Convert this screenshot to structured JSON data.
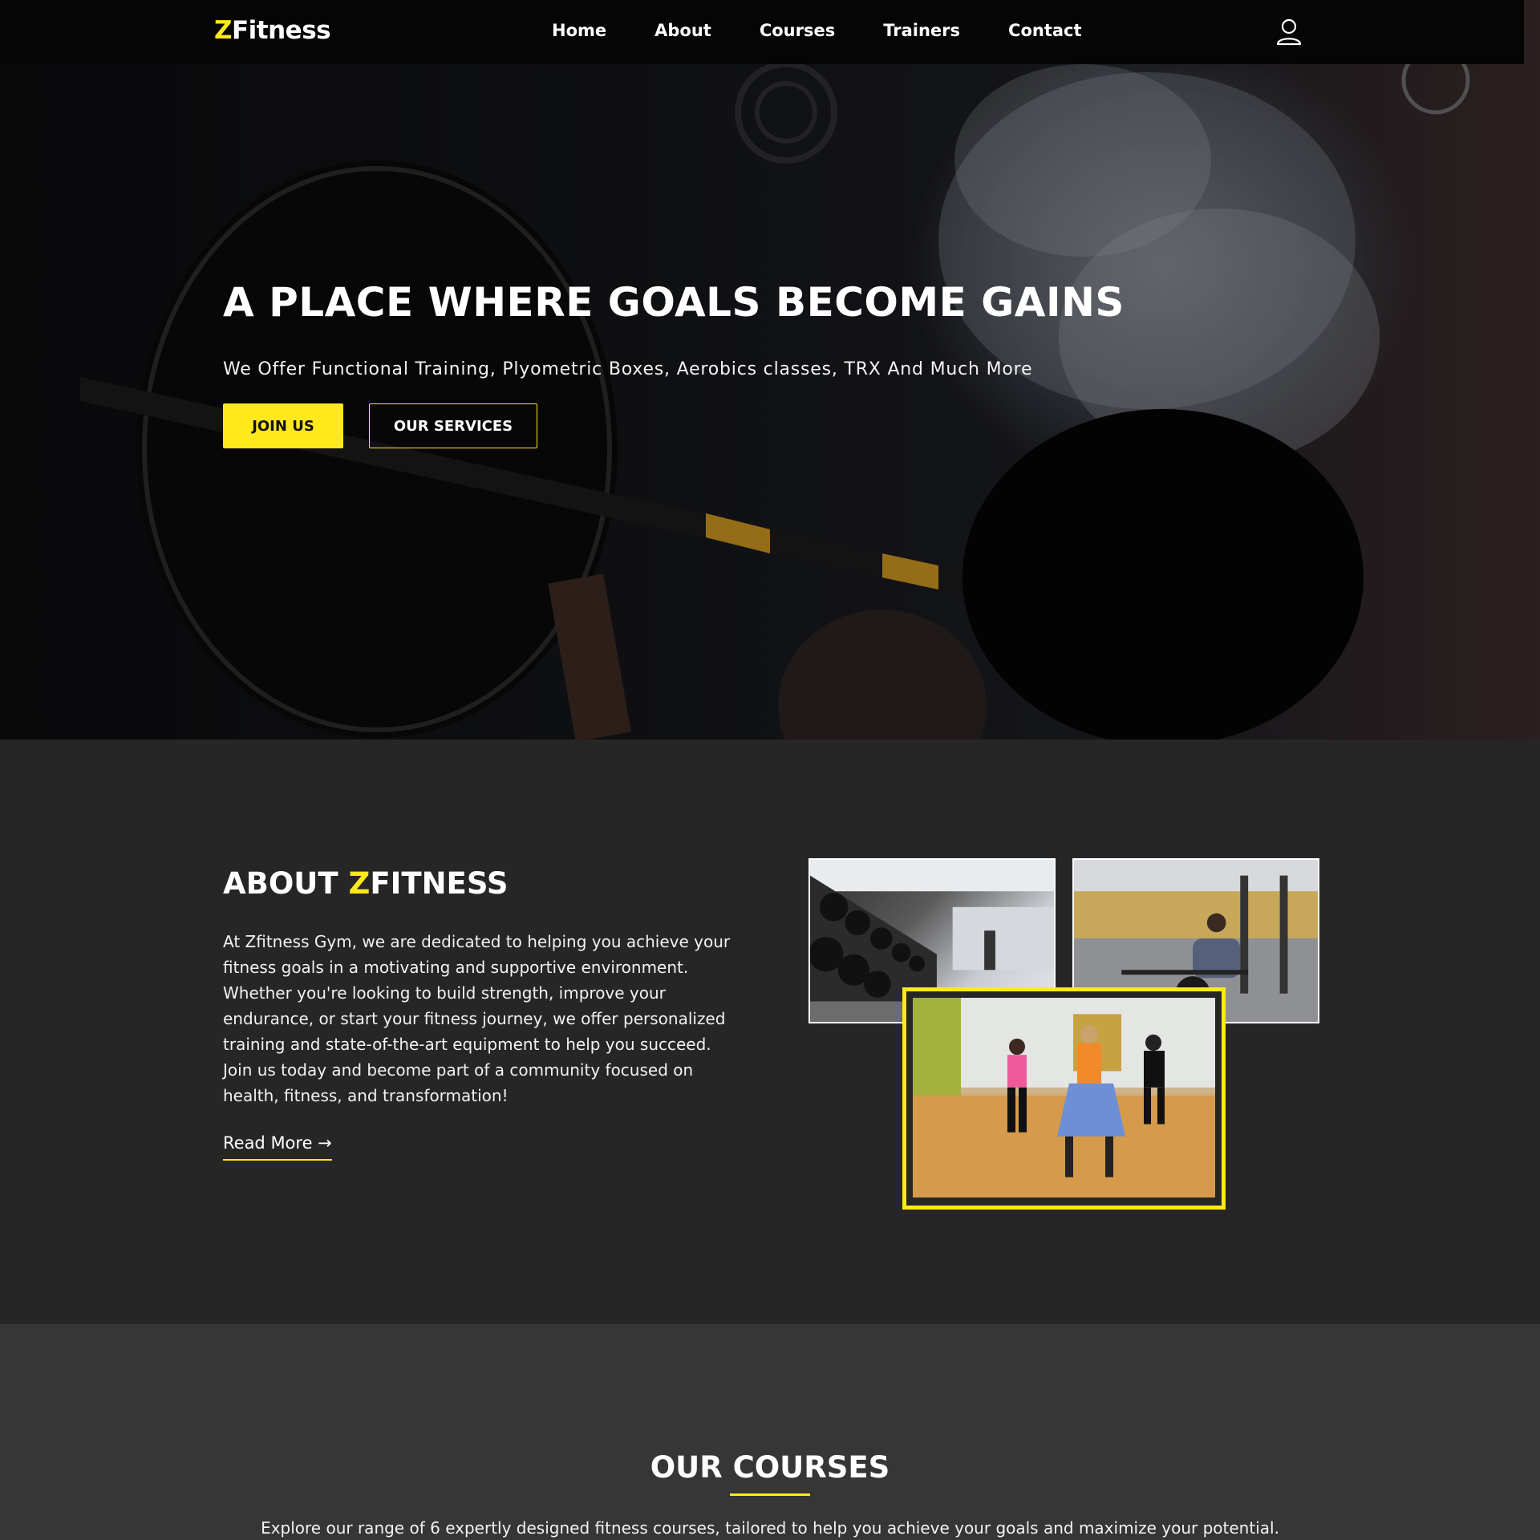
{
  "nav": {
    "logo_z": "Z",
    "logo_rest": "Fitness",
    "links": [
      "Home",
      "About",
      "Courses",
      "Trainers",
      "Contact"
    ],
    "user_icon": "user-icon"
  },
  "hero": {
    "title": "A PLACE WHERE GOALS BECOME GAINS",
    "subtitle": "We Offer Functional Training, Plyometric Boxes, Aerobics classes, TRX And Much More",
    "join_label": "JOIN US",
    "services_label": "OUR SERVICES"
  },
  "about": {
    "title_prefix": "ABOUT ",
    "title_z": "Z",
    "title_rest": "FITNESS",
    "text": "At Zfitness Gym, we are dedicated to helping you achieve your fitness goals in a motivating and supportive environment. Whether you're looking to build strength, improve your endurance, or start your fitness journey, we offer personalized training and state-of-the-art equipment to help you succeed. Join us today and become part of a community focused on health, fitness, and transformation!",
    "read_more": "Read More →"
  },
  "courses": {
    "title": "OUR COURSES",
    "text": "Explore our range of 6 expertly designed fitness courses, tailored to help you achieve your goals and maximize your potential."
  },
  "colors": {
    "accent": "#ffe81c",
    "nav_bg": "#050505",
    "about_bg": "#262626",
    "courses_bg": "#363636"
  }
}
